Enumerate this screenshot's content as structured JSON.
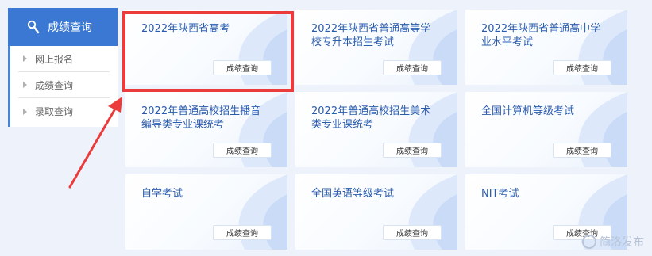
{
  "sidebar": {
    "header": "成绩查询",
    "items": [
      {
        "label": "网上报名"
      },
      {
        "label": "成绩查询"
      },
      {
        "label": "录取查询"
      }
    ]
  },
  "cards": [
    {
      "title": "2022年陕西省高考",
      "button": "成绩查询"
    },
    {
      "title": "2022年陕西省普通高等学校专升本招生考试",
      "button": "成绩查询"
    },
    {
      "title": "2022年陕西省普通高中学业水平考试",
      "button": "成绩查询"
    },
    {
      "title": "2022年普通高校招生播音编导类专业课统考",
      "button": "成绩查询"
    },
    {
      "title": "2022年普通高校招生美术类专业课统考",
      "button": "成绩查询"
    },
    {
      "title": "全国计算机等级考试",
      "button": "成绩查询"
    },
    {
      "title": "自学考试",
      "button": "成绩查询"
    },
    {
      "title": "全国英语等级考试",
      "button": "成绩查询"
    },
    {
      "title": "NIT考试",
      "button": "成绩查询"
    }
  ],
  "watermark": "简洛发布",
  "colors": {
    "primary": "#3a78d4",
    "card_title": "#2a5cae",
    "highlight": "#ec3b3b"
  },
  "icons": {
    "sidebar_header": "magnifier-icon",
    "item_marker": "triangle-right-icon"
  }
}
